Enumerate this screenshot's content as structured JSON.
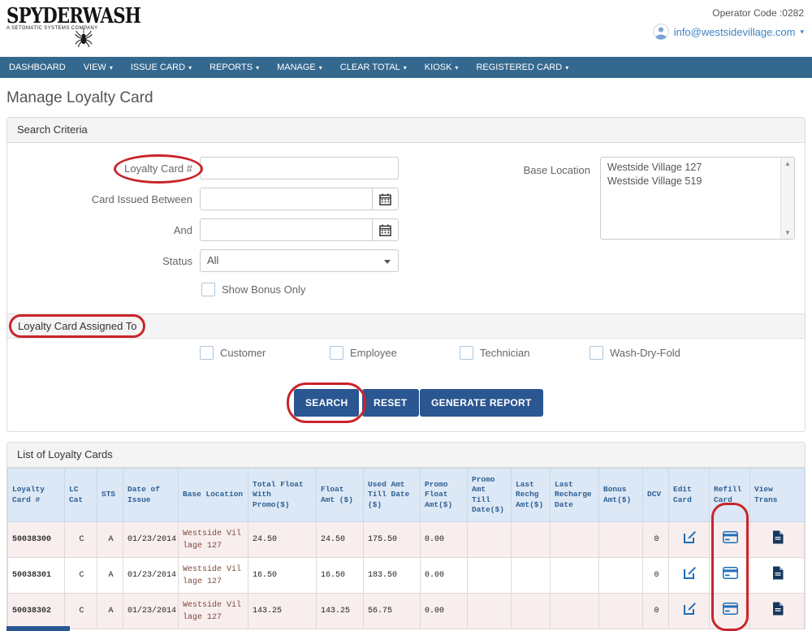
{
  "colors": {
    "nav_bg": "#35688f",
    "button_bg": "#2a5691",
    "annotation": "#c9252b",
    "link": "#3e83c4",
    "table_header_bg": "#dce8f5",
    "row_alt_bg": "#f8eeee"
  },
  "header": {
    "logo_title": "SPYDERWASH",
    "logo_subtitle": "A SETOMATIC SYSTEMS COMPANY",
    "operator_code": "Operator Code :0282",
    "account_email": "info@westsidevillage.com"
  },
  "nav": {
    "items": [
      {
        "label": "DASHBOARD",
        "dropdown": false
      },
      {
        "label": "VIEW",
        "dropdown": true
      },
      {
        "label": "ISSUE CARD",
        "dropdown": true
      },
      {
        "label": "REPORTS",
        "dropdown": true
      },
      {
        "label": "MANAGE",
        "dropdown": true
      },
      {
        "label": "CLEAR TOTAL",
        "dropdown": true
      },
      {
        "label": "KIOSK",
        "dropdown": true
      },
      {
        "label": "REGISTERED CARD",
        "dropdown": true
      }
    ]
  },
  "page": {
    "title": "Manage Loyalty Card"
  },
  "search": {
    "panel_title": "Search Criteria",
    "loyalty_card_label": "Loyalty Card #",
    "loyalty_card_value": "",
    "issued_between_label": "Card Issued Between",
    "issued_between_value": "",
    "and_label": "And",
    "and_value": "",
    "status_label": "Status",
    "status_value": "All",
    "show_bonus_label": "Show Bonus Only",
    "base_location_label": "Base Location",
    "base_location_options": [
      "Westside Village 127",
      "Westside Village 519"
    ],
    "assigned_to_title": "Loyalty Card Assigned To",
    "assigned_options": [
      "Customer",
      "Employee",
      "Technician",
      "Wash-Dry-Fold"
    ],
    "buttons": {
      "search": "SEARCH",
      "reset": "RESET",
      "generate": "GENERATE REPORT"
    }
  },
  "table": {
    "panel_title": "List of Loyalty Cards",
    "columns": [
      "Loyalty Card #",
      "LC Cat",
      "STS",
      "Date of Issue",
      "Base Location",
      "Total Float With Promo($)",
      "Float Amt ($)",
      "Used Amt Till Date ($)",
      "Promo Float Amt($)",
      "Promo Amt Till Date($)",
      "Last Rechg Amt($)",
      "Last Recharge Date",
      "Bonus Amt($)",
      "DCV",
      "Edit Card",
      "Refill Card",
      "View Trans"
    ],
    "rows": [
      [
        "50038300",
        "C",
        "A",
        "01/23/2014",
        "Westside Village 127",
        "24.50",
        "24.50",
        "175.50",
        "0.00",
        "",
        "",
        "",
        "",
        "0"
      ],
      [
        "50038301",
        "C",
        "A",
        "01/23/2014",
        "Westside Village 127",
        "16.50",
        "16.50",
        "183.50",
        "0.00",
        "",
        "",
        "",
        "",
        "0"
      ],
      [
        "50038302",
        "C",
        "A",
        "01/23/2014",
        "Westside Village 127",
        "143.25",
        "143.25",
        "56.75",
        "0.00",
        "",
        "",
        "",
        "",
        "0"
      ]
    ]
  }
}
